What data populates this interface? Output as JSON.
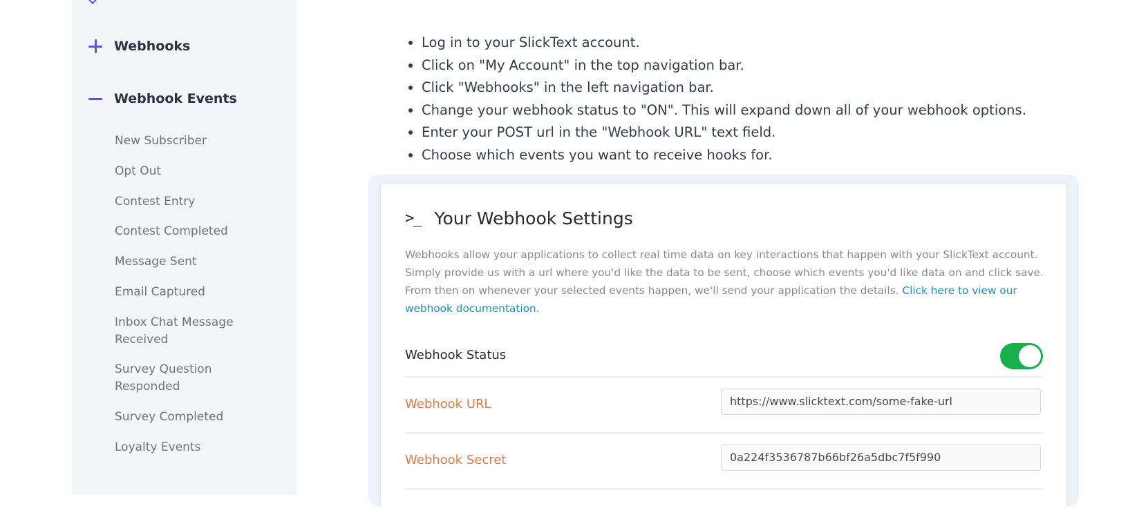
{
  "sidebar": {
    "webhooks_label": "Webhooks",
    "webhook_events_label": "Webhook Events",
    "events": [
      "New Subscriber",
      "Opt Out",
      "Contest Entry",
      "Contest Completed",
      "Message Sent",
      "Email Captured",
      "Inbox Chat Message Received",
      "Survey Question Responded",
      "Survey Completed",
      "Loyalty Events"
    ]
  },
  "main": {
    "steps": [
      "Log in to your SlickText account.",
      "Click on \"My Account\" in the top navigation bar.",
      "Click \"Webhooks\" in the left navigation bar.",
      "Change your webhook status to \"ON\". This will expand down all of your webhook options.",
      "Enter your POST url in the \"Webhook URL\" text field.",
      "Choose which events you want to receive hooks for."
    ],
    "settings_card": {
      "icon": ">_",
      "title": "Your Webhook Settings",
      "description": "Webhooks allow your applications to collect real time data on key interactions that happen with your SlickText account. Simply provide us with a url where you'd like the data to be sent, choose which events you'd like data on and click save. From then on whenever your selected events happen, we'll send your application the details. ",
      "link_text": "Click here to view our webhook documentation",
      "desc_end": ".",
      "status_label": "Webhook Status",
      "status_on": true,
      "url_label": "Webhook URL",
      "url_value": "https://www.slicktext.com/some-fake-url",
      "secret_label": "Webhook Secret",
      "secret_value": "0a224f3536787b66bf26a5dbc7f5f990"
    }
  },
  "colors": {
    "accent": "#4f5bd5",
    "toggle_on": "#17b04b",
    "label_orange": "#e07a42",
    "link": "#1c8fc4"
  }
}
